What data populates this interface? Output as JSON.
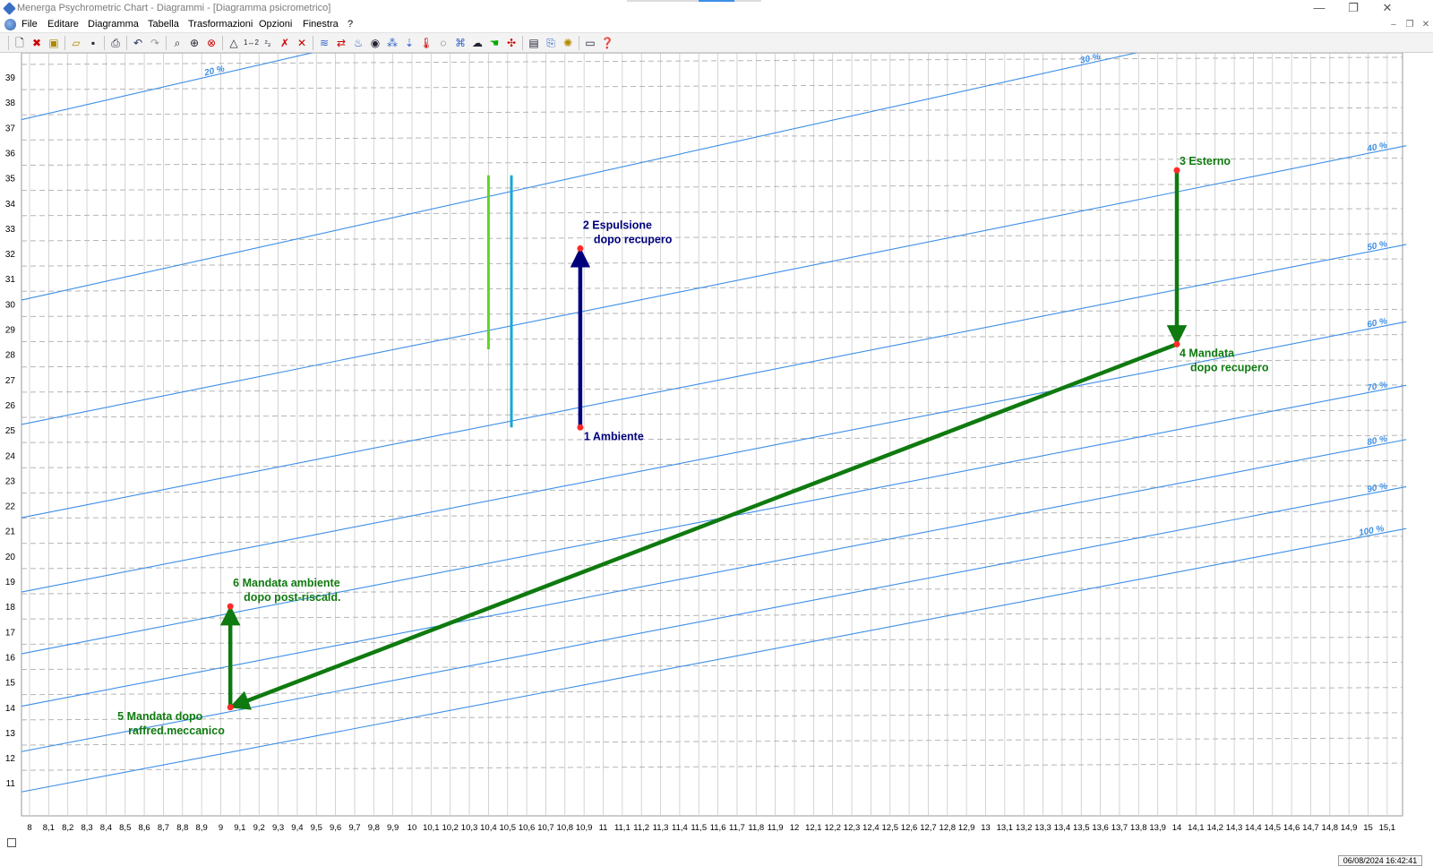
{
  "window": {
    "title": "Menerga Psychrometric Chart  -  Diagrammi - [Diagramma psicrometrico]",
    "buttons": {
      "minimize": "—",
      "restore": "❐",
      "close": "✕"
    }
  },
  "menubar": {
    "items": [
      "File",
      "Editare",
      "Diagramma",
      "Tabella",
      "Trasformazioni",
      "Opzioni",
      "Finestra",
      "?"
    ],
    "mdi_controls": {
      "minimize": "–",
      "restore": "❐",
      "close": "✕"
    }
  },
  "toolbar": {
    "icons": [
      "new-document-icon",
      "close-document-icon",
      "properties-icon",
      "open-folder-icon",
      "save-icon",
      "print-icon",
      "undo-icon",
      "redo-icon",
      "zoom-icon",
      "zoom-in-icon",
      "zoom-cancel-icon",
      "triangle-icon",
      "point-1-2-icon",
      "point-2-3-icon",
      "delete-point-icon",
      "delete-all-icon",
      "mixing-icon",
      "transfer-icon",
      "heating-icon",
      "cooling-icon",
      "humidify-icon",
      "steam-icon",
      "thermometer-icon",
      "circle-icon",
      "recovery-icon",
      "cloud-icon",
      "hand-icon",
      "fan-icon",
      "table-icon",
      "copy-icon",
      "settings-icon",
      "window-icon",
      "help-icon"
    ]
  },
  "chart_data": {
    "type": "psychrometric",
    "x_label": "",
    "y_label": "",
    "x_ticks": [
      "8",
      "8,1",
      "8,2",
      "8,3",
      "8,4",
      "8,5",
      "8,6",
      "8,7",
      "8,8",
      "8,9",
      "9",
      "9,1",
      "9,2",
      "9,3",
      "9,4",
      "9,5",
      "9,6",
      "9,7",
      "9,8",
      "9,9",
      "10",
      "10,1",
      "10,2",
      "10,3",
      "10,4",
      "10,5",
      "10,6",
      "10,7",
      "10,8",
      "10,9",
      "11",
      "11,1",
      "11,2",
      "11,3",
      "11,4",
      "11,5",
      "11,6",
      "11,7",
      "11,8",
      "11,9",
      "12",
      "12,1",
      "12,2",
      "12,3",
      "12,4",
      "12,5",
      "12,6",
      "12,7",
      "12,8",
      "12,9",
      "13",
      "13,1",
      "13,2",
      "13,3",
      "13,4",
      "13,5",
      "13,6",
      "13,7",
      "13,8",
      "13,9",
      "14",
      "14,1",
      "14,2",
      "14,3",
      "14,4",
      "14,5",
      "14,6",
      "14,7",
      "14,8",
      "14,9",
      "15",
      "15,1"
    ],
    "x_range": [
      7.95,
      15.2
    ],
    "y_ticks": [
      "11",
      "12",
      "13",
      "14",
      "15",
      "16",
      "17",
      "18",
      "19",
      "20",
      "21",
      "22",
      "23",
      "24",
      "25",
      "26",
      "27",
      "28",
      "29",
      "30",
      "31",
      "32",
      "33",
      "34",
      "35",
      "36",
      "37",
      "38",
      "39"
    ],
    "y_range": [
      10.0,
      40.0
    ],
    "rh_curves": [
      {
        "label": "20 %",
        "y_at_x8": 37.38,
        "y_at_x15": 49.6
      },
      {
        "label": "30 %",
        "y_at_x8": 30.22,
        "y_at_x15": 42.0
      },
      {
        "label": "40 %",
        "y_at_x8": 25.28,
        "y_at_x15": 35.97
      },
      {
        "label": "50 %",
        "y_at_x8": 21.58,
        "y_at_x15": 32.06
      },
      {
        "label": "60 %",
        "y_at_x8": 18.63,
        "y_at_x15": 29.0
      },
      {
        "label": "70 %",
        "y_at_x8": 16.18,
        "y_at_x15": 26.48
      },
      {
        "label": "80 %",
        "y_at_x8": 14.1,
        "y_at_x15": 24.33
      },
      {
        "label": "90 %",
        "y_at_x8": 12.3,
        "y_at_x15": 22.46
      },
      {
        "label": "100 %",
        "y_at_x8": 10.7,
        "y_at_x15": 20.8
      }
    ],
    "enthalpy_dashes_y": [
      11.5,
      12.5,
      13.5,
      14.5,
      15.5,
      16.5,
      17.5,
      18.5,
      19.5,
      20.5,
      21.5,
      22.5,
      23.5,
      24.5,
      25.5,
      26.5,
      27.5,
      28.5,
      29.5,
      30.5,
      31.5,
      32.5,
      33.5,
      34.5,
      35.5,
      36.5,
      37.5,
      38.5,
      39.5
    ],
    "points": [
      {
        "id": "1",
        "x": 10.88,
        "y": 25.1,
        "label_lines": [
          "1 Ambiente"
        ],
        "color": "#00007b"
      },
      {
        "id": "2",
        "x": 10.88,
        "y": 32.2,
        "label_lines": [
          "2 Espulsione",
          "dopo recupero"
        ],
        "color": "#00007b"
      },
      {
        "id": "3",
        "x": 14.0,
        "y": 35.3,
        "label_lines": [
          "3 Esterno"
        ],
        "color": "#0f7a0f"
      },
      {
        "id": "4",
        "x": 14.0,
        "y": 28.4,
        "label_lines": [
          "4 Mandata",
          "dopo recupero"
        ],
        "color": "#0f7a0f"
      },
      {
        "id": "5",
        "x": 9.05,
        "y": 14.0,
        "label_lines": [
          "5 Mandata dopo",
          "raffred.meccanico"
        ],
        "color": "#0f7a0f"
      },
      {
        "id": "6",
        "x": 9.05,
        "y": 18.0,
        "label_lines": [
          "6 Mandata ambiente",
          "dopo post-riscald."
        ],
        "color": "#0f7a0f"
      }
    ],
    "processes": [
      {
        "from": "1",
        "to": "2",
        "color": "#00007b"
      },
      {
        "from": "3",
        "to": "4",
        "color": "#0f7a0f"
      },
      {
        "from": "4",
        "to": "5",
        "color": "#0f7a0f"
      },
      {
        "from": "5",
        "to": "6",
        "color": "#0f7a0f"
      }
    ],
    "bars": [
      {
        "x": 10.4,
        "y_from": 28.2,
        "y_to": 35.1,
        "color": "#5ed42a"
      },
      {
        "x": 10.52,
        "y_from": 25.1,
        "y_to": 35.1,
        "color": "#17a8d6"
      }
    ],
    "colors": {
      "rh_line": "#3c8fe6",
      "rh_label": "#3c8fe6",
      "point": "#ff2b2b",
      "grid": "#c9c9c9"
    }
  },
  "status": {
    "datetime": "06/08/2024 16:42:41"
  }
}
